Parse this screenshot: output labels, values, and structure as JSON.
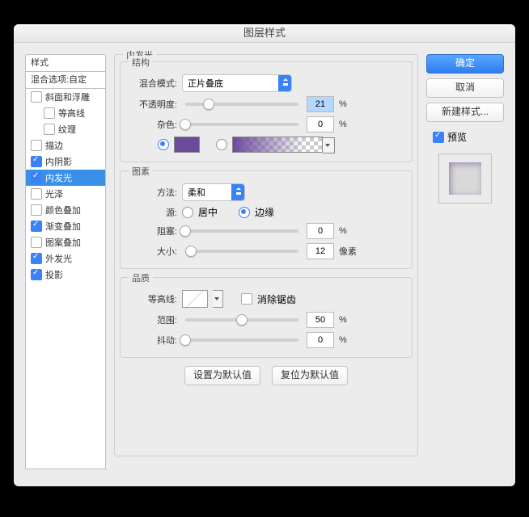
{
  "title": "图层样式",
  "left": {
    "styles_header": "样式",
    "blend_opts": "混合选项:自定",
    "items": [
      {
        "label": "斜面和浮雕",
        "checked": false,
        "indent": false
      },
      {
        "label": "等高线",
        "checked": false,
        "indent": true
      },
      {
        "label": "纹理",
        "checked": false,
        "indent": true
      },
      {
        "label": "描边",
        "checked": false,
        "indent": false
      },
      {
        "label": "内阴影",
        "checked": true,
        "indent": false
      },
      {
        "label": "内发光",
        "checked": true,
        "indent": false,
        "selected": true
      },
      {
        "label": "光泽",
        "checked": false,
        "indent": false
      },
      {
        "label": "颜色叠加",
        "checked": false,
        "indent": false
      },
      {
        "label": "渐变叠加",
        "checked": true,
        "indent": false
      },
      {
        "label": "图案叠加",
        "checked": false,
        "indent": false
      },
      {
        "label": "外发光",
        "checked": true,
        "indent": false
      },
      {
        "label": "投影",
        "checked": true,
        "indent": false
      }
    ]
  },
  "panel": {
    "title": "内发光",
    "struct": {
      "title": "结构",
      "blend_mode_label": "混合模式:",
      "blend_mode_value": "正片叠底",
      "opacity_label": "不透明度:",
      "opacity_value": "21",
      "noise_label": "杂色:",
      "noise_value": "0",
      "percent": "%",
      "color_hex": "#6b4a9a"
    },
    "elem": {
      "title": "图素",
      "method_label": "方法:",
      "method_value": "柔和",
      "source_label": "源:",
      "source_center": "居中",
      "source_edge": "边缘",
      "choke_label": "阻塞:",
      "choke_value": "0",
      "size_label": "大小:",
      "size_value": "12",
      "percent": "%",
      "px": "像素"
    },
    "quality": {
      "title": "品质",
      "contour_label": "等高线:",
      "anti_alias": "消除锯齿",
      "range_label": "范围:",
      "range_value": "50",
      "jitter_label": "抖动:",
      "jitter_value": "0",
      "percent": "%"
    },
    "defaults_set": "设置为默认值",
    "defaults_reset": "复位为默认值"
  },
  "right": {
    "ok": "确定",
    "cancel": "取消",
    "new_style": "新建样式...",
    "preview_label": "预览",
    "preview_checked": true
  }
}
